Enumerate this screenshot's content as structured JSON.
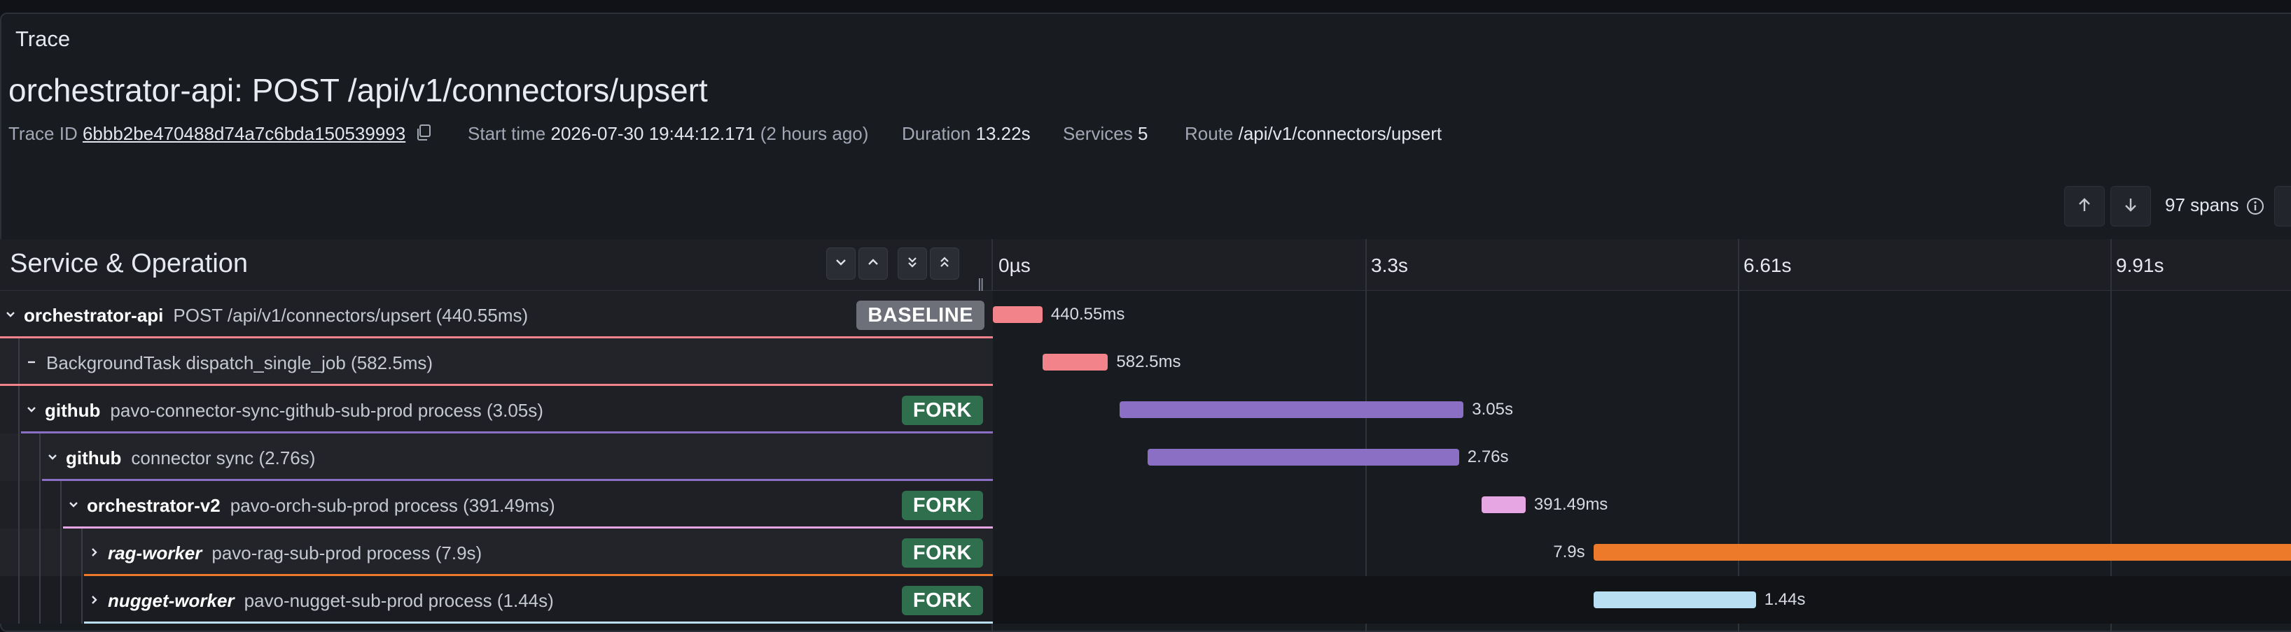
{
  "panel": {
    "title": "Trace"
  },
  "trace": {
    "title": "orchestrator-api: POST /api/v1/connectors/upsert",
    "trace_id_label": "Trace ID",
    "trace_id": "6bbb2be470488d74a7c6bda150539993",
    "start_label": "Start time",
    "start_value": "2026-07-30 19:44:12.171",
    "start_relative": "(2 hours ago)",
    "duration_label": "Duration",
    "duration_value": "13.22s",
    "services_label": "Services",
    "services_value": "5",
    "route_label": "Route",
    "route_value": "/api/v1/connectors/upsert"
  },
  "toolbar": {
    "spans_count": "97 spans"
  },
  "table": {
    "header_title": "Service & Operation",
    "ticks": [
      "0µs",
      "3.3s",
      "6.61s",
      "9.91s"
    ]
  },
  "rows": [
    {
      "service": "orchestrator-api",
      "operation": "POST /api/v1/connectors/upsert (440.55ms)",
      "badge": "BASELINE",
      "bar_label": "440.55ms",
      "color": "#f2838b",
      "start_s": 0.0,
      "duration_s": 0.44
    },
    {
      "service": "",
      "operation": "BackgroundTask dispatch_single_job (582.5ms)",
      "badge": "",
      "bar_label": "582.5ms",
      "color": "#f2838b",
      "start_s": 0.44,
      "duration_s": 0.58
    },
    {
      "service": "github",
      "operation": "pavo-connector-sync-github-sub-prod process (3.05s)",
      "badge": "FORK",
      "bar_label": "3.05s",
      "color": "#8a6fc4",
      "start_s": 1.12,
      "duration_s": 3.05
    },
    {
      "service": "github",
      "operation": "connector sync (2.76s)",
      "badge": "",
      "bar_label": "2.76s",
      "color": "#8a6fc4",
      "start_s": 1.37,
      "duration_s": 2.76
    },
    {
      "service": "orchestrator-v2",
      "operation": "pavo-orch-sub-prod process (391.49ms)",
      "badge": "FORK",
      "bar_label": "391.49ms",
      "color": "#e6a6e3",
      "start_s": 4.33,
      "duration_s": 0.39
    },
    {
      "service": "rag-worker",
      "operation": "pavo-rag-sub-prod process (7.9s)",
      "badge": "FORK",
      "bar_label": "7.9s",
      "color": "#ec7a2a",
      "start_s": 5.32,
      "duration_s": 7.9
    },
    {
      "service": "nugget-worker",
      "operation": "pavo-nugget-sub-prod process (1.44s)",
      "badge": "FORK",
      "bar_label": "1.44s",
      "color": "#b9dff3",
      "start_s": 5.32,
      "duration_s": 1.44
    }
  ]
}
